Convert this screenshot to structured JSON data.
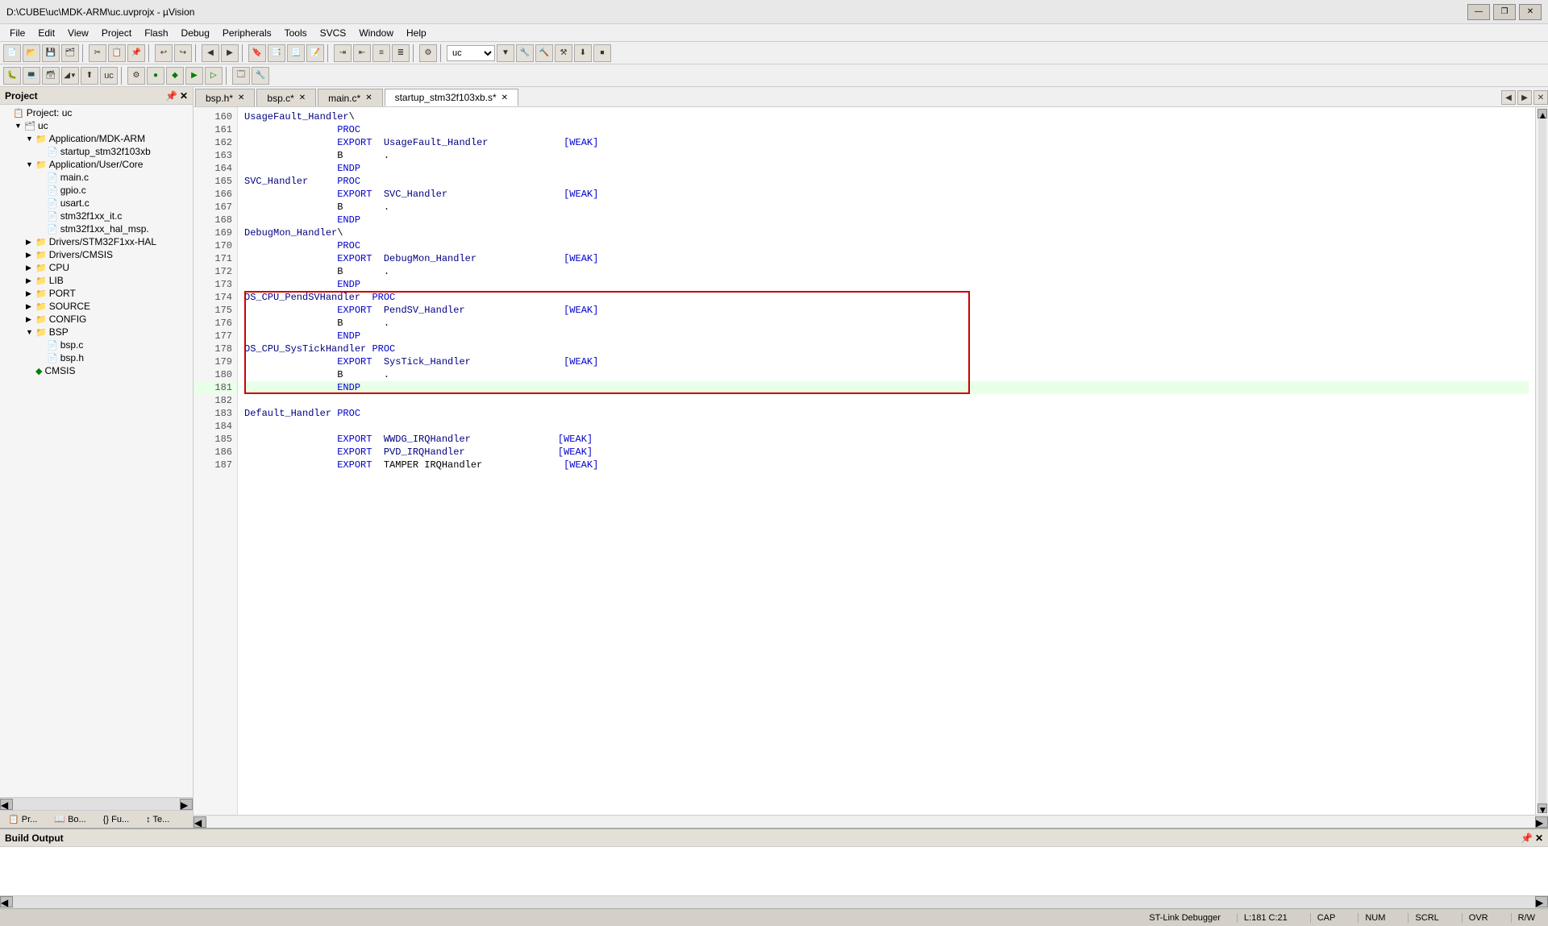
{
  "titlebar": {
    "title": "D:\\CUBE\\uc\\MDK-ARM\\uc.uvprojx - µVision",
    "min": "—",
    "max": "❐",
    "close": "✕"
  },
  "menu": {
    "items": [
      "File",
      "Edit",
      "View",
      "Project",
      "Flash",
      "Debug",
      "Peripherals",
      "Tools",
      "SVCS",
      "Window",
      "Help"
    ]
  },
  "project": {
    "title": "Project",
    "tree": [
      {
        "id": "root",
        "label": "Project: uc",
        "indent": 0,
        "icon": "📋",
        "arrow": ""
      },
      {
        "id": "uc",
        "label": "uc",
        "indent": 1,
        "icon": "💼",
        "arrow": "▼"
      },
      {
        "id": "app-mdk",
        "label": "Application/MDK-ARM",
        "indent": 2,
        "icon": "📁",
        "arrow": "▼"
      },
      {
        "id": "startup",
        "label": "startup_stm32f103xb",
        "indent": 3,
        "icon": "📄",
        "arrow": ""
      },
      {
        "id": "app-user",
        "label": "Application/User/Core",
        "indent": 2,
        "icon": "📁",
        "arrow": "▼"
      },
      {
        "id": "main-c",
        "label": "main.c",
        "indent": 3,
        "icon": "📄",
        "arrow": ""
      },
      {
        "id": "gpio-c",
        "label": "gpio.c",
        "indent": 3,
        "icon": "📄",
        "arrow": ""
      },
      {
        "id": "usart-c",
        "label": "usart.c",
        "indent": 3,
        "icon": "📄",
        "arrow": ""
      },
      {
        "id": "stm32f1xx-it",
        "label": "stm32f1xx_it.c",
        "indent": 3,
        "icon": "📄",
        "arrow": ""
      },
      {
        "id": "stm32f1xx-hal",
        "label": "stm32f1xx_hal_msp.",
        "indent": 3,
        "icon": "📄",
        "arrow": ""
      },
      {
        "id": "drivers-stm32",
        "label": "Drivers/STM32F1xx-HAL",
        "indent": 2,
        "icon": "📁",
        "arrow": "▶"
      },
      {
        "id": "drivers-cmsis",
        "label": "Drivers/CMSIS",
        "indent": 2,
        "icon": "📁",
        "arrow": "▶"
      },
      {
        "id": "cpu",
        "label": "CPU",
        "indent": 2,
        "icon": "📁",
        "arrow": "▶"
      },
      {
        "id": "lib",
        "label": "LIB",
        "indent": 2,
        "icon": "📁",
        "arrow": "▶"
      },
      {
        "id": "port",
        "label": "PORT",
        "indent": 2,
        "icon": "📁",
        "arrow": "▶"
      },
      {
        "id": "source",
        "label": "SOURCE",
        "indent": 2,
        "icon": "📁",
        "arrow": "▶"
      },
      {
        "id": "config",
        "label": "CONFIG",
        "indent": 2,
        "icon": "📁",
        "arrow": "▶"
      },
      {
        "id": "bsp",
        "label": "BSP",
        "indent": 2,
        "icon": "📁",
        "arrow": "▼"
      },
      {
        "id": "bsp-c",
        "label": "bsp.c",
        "indent": 3,
        "icon": "📄",
        "arrow": ""
      },
      {
        "id": "bsp-h",
        "label": "bsp.h",
        "indent": 3,
        "icon": "📄",
        "arrow": ""
      },
      {
        "id": "cmsis",
        "label": "CMSIS",
        "indent": 2,
        "icon": "♦",
        "arrow": ""
      }
    ]
  },
  "tabs": {
    "items": [
      {
        "label": "bsp.h",
        "active": false,
        "modified": true
      },
      {
        "label": "bsp.c",
        "active": false,
        "modified": true
      },
      {
        "label": "main.c",
        "active": false,
        "modified": true
      },
      {
        "label": "startup_stm32f103xb.s",
        "active": true,
        "modified": true
      }
    ]
  },
  "editor": {
    "filename": "startup_stm32f103xb.s",
    "lines": [
      {
        "num": 160,
        "code": "UsageFault_Handler\\",
        "highlight": false
      },
      {
        "num": 161,
        "code": "                PROC",
        "highlight": false
      },
      {
        "num": 162,
        "code": "                EXPORT  UsageFault_Handler             [WEAK]",
        "highlight": false
      },
      {
        "num": 163,
        "code": "                B       .",
        "highlight": false
      },
      {
        "num": 164,
        "code": "                ENDP",
        "highlight": false
      },
      {
        "num": 165,
        "code": "SVC_Handler     PROC",
        "highlight": false
      },
      {
        "num": 166,
        "code": "                EXPORT  SVC_Handler                    [WEAK]",
        "highlight": false
      },
      {
        "num": 167,
        "code": "                B       .",
        "highlight": false
      },
      {
        "num": 168,
        "code": "                ENDP",
        "highlight": false
      },
      {
        "num": 169,
        "code": "DebugMon_Handler\\",
        "highlight": false
      },
      {
        "num": 170,
        "code": "                PROC",
        "highlight": false
      },
      {
        "num": 171,
        "code": "                EXPORT  DebugMon_Handler               [WEAK]",
        "highlight": false
      },
      {
        "num": 172,
        "code": "                B       .",
        "highlight": false
      },
      {
        "num": 173,
        "code": "                ENDP",
        "highlight": false
      },
      {
        "num": 174,
        "code": "OS_CPU_PendSVHandler  PROC",
        "highlight": false,
        "boxStart": true
      },
      {
        "num": 175,
        "code": "                EXPORT  PendSV_Handler                 [WEAK]",
        "highlight": false
      },
      {
        "num": 176,
        "code": "                B       .",
        "highlight": false
      },
      {
        "num": 177,
        "code": "                ENDP",
        "highlight": false
      },
      {
        "num": 178,
        "code": "OS_CPU_SysTickHandler PROC",
        "highlight": false
      },
      {
        "num": 179,
        "code": "                EXPORT  SysTick_Handler                [WEAK]",
        "highlight": false
      },
      {
        "num": 180,
        "code": "                B       .",
        "highlight": false
      },
      {
        "num": 181,
        "code": "                ENDP",
        "highlight": true,
        "boxEnd": true
      },
      {
        "num": 182,
        "code": "",
        "highlight": false
      },
      {
        "num": 183,
        "code": "Default_Handler PROC",
        "highlight": false
      },
      {
        "num": 184,
        "code": "",
        "highlight": false
      },
      {
        "num": 185,
        "code": "                EXPORT  WWDG_IRQHandler               [WEAK]",
        "highlight": false
      },
      {
        "num": 186,
        "code": "                EXPORT  PVD_IRQHandler                [WEAK]",
        "highlight": false
      },
      {
        "num": 187,
        "code": "                EXPORT  TAMPER IRQHandler              [WEAK]",
        "highlight": false
      }
    ]
  },
  "bottom": {
    "title": "Build Output",
    "tabs": [
      "Pr...",
      "Bo...",
      "{} Fu...",
      "↕ Te..."
    ]
  },
  "statusbar": {
    "debugger": "ST-Link Debugger",
    "position": "L:181 C:21",
    "caps": "CAP",
    "num": "NUM",
    "scrl": "SCRL",
    "ovr": "OVR",
    "rw": "R/W"
  }
}
